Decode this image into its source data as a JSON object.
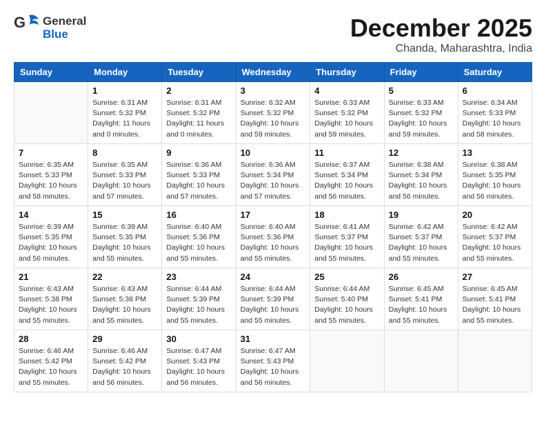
{
  "header": {
    "logo_general": "General",
    "logo_blue": "Blue",
    "month": "December 2025",
    "location": "Chanda, Maharashtra, India"
  },
  "weekdays": [
    "Sunday",
    "Monday",
    "Tuesday",
    "Wednesday",
    "Thursday",
    "Friday",
    "Saturday"
  ],
  "weeks": [
    [
      {
        "day": "",
        "info": ""
      },
      {
        "day": "1",
        "info": "Sunrise: 6:31 AM\nSunset: 5:32 PM\nDaylight: 11 hours\nand 0 minutes."
      },
      {
        "day": "2",
        "info": "Sunrise: 6:31 AM\nSunset: 5:32 PM\nDaylight: 11 hours\nand 0 minutes."
      },
      {
        "day": "3",
        "info": "Sunrise: 6:32 AM\nSunset: 5:32 PM\nDaylight: 10 hours\nand 59 minutes."
      },
      {
        "day": "4",
        "info": "Sunrise: 6:33 AM\nSunset: 5:32 PM\nDaylight: 10 hours\nand 59 minutes."
      },
      {
        "day": "5",
        "info": "Sunrise: 6:33 AM\nSunset: 5:32 PM\nDaylight: 10 hours\nand 59 minutes."
      },
      {
        "day": "6",
        "info": "Sunrise: 6:34 AM\nSunset: 5:33 PM\nDaylight: 10 hours\nand 58 minutes."
      }
    ],
    [
      {
        "day": "7",
        "info": "Sunrise: 6:35 AM\nSunset: 5:33 PM\nDaylight: 10 hours\nand 58 minutes."
      },
      {
        "day": "8",
        "info": "Sunrise: 6:35 AM\nSunset: 5:33 PM\nDaylight: 10 hours\nand 57 minutes."
      },
      {
        "day": "9",
        "info": "Sunrise: 6:36 AM\nSunset: 5:33 PM\nDaylight: 10 hours\nand 57 minutes."
      },
      {
        "day": "10",
        "info": "Sunrise: 6:36 AM\nSunset: 5:34 PM\nDaylight: 10 hours\nand 57 minutes."
      },
      {
        "day": "11",
        "info": "Sunrise: 6:37 AM\nSunset: 5:34 PM\nDaylight: 10 hours\nand 56 minutes."
      },
      {
        "day": "12",
        "info": "Sunrise: 6:38 AM\nSunset: 5:34 PM\nDaylight: 10 hours\nand 56 minutes."
      },
      {
        "day": "13",
        "info": "Sunrise: 6:38 AM\nSunset: 5:35 PM\nDaylight: 10 hours\nand 56 minutes."
      }
    ],
    [
      {
        "day": "14",
        "info": "Sunrise: 6:39 AM\nSunset: 5:35 PM\nDaylight: 10 hours\nand 56 minutes."
      },
      {
        "day": "15",
        "info": "Sunrise: 6:39 AM\nSunset: 5:35 PM\nDaylight: 10 hours\nand 55 minutes."
      },
      {
        "day": "16",
        "info": "Sunrise: 6:40 AM\nSunset: 5:36 PM\nDaylight: 10 hours\nand 55 minutes."
      },
      {
        "day": "17",
        "info": "Sunrise: 6:40 AM\nSunset: 5:36 PM\nDaylight: 10 hours\nand 55 minutes."
      },
      {
        "day": "18",
        "info": "Sunrise: 6:41 AM\nSunset: 5:37 PM\nDaylight: 10 hours\nand 55 minutes."
      },
      {
        "day": "19",
        "info": "Sunrise: 6:42 AM\nSunset: 5:37 PM\nDaylight: 10 hours\nand 55 minutes."
      },
      {
        "day": "20",
        "info": "Sunrise: 6:42 AM\nSunset: 5:37 PM\nDaylight: 10 hours\nand 55 minutes."
      }
    ],
    [
      {
        "day": "21",
        "info": "Sunrise: 6:43 AM\nSunset: 5:38 PM\nDaylight: 10 hours\nand 55 minutes."
      },
      {
        "day": "22",
        "info": "Sunrise: 6:43 AM\nSunset: 5:38 PM\nDaylight: 10 hours\nand 55 minutes."
      },
      {
        "day": "23",
        "info": "Sunrise: 6:44 AM\nSunset: 5:39 PM\nDaylight: 10 hours\nand 55 minutes."
      },
      {
        "day": "24",
        "info": "Sunrise: 6:44 AM\nSunset: 5:39 PM\nDaylight: 10 hours\nand 55 minutes."
      },
      {
        "day": "25",
        "info": "Sunrise: 6:44 AM\nSunset: 5:40 PM\nDaylight: 10 hours\nand 55 minutes."
      },
      {
        "day": "26",
        "info": "Sunrise: 6:45 AM\nSunset: 5:41 PM\nDaylight: 10 hours\nand 55 minutes."
      },
      {
        "day": "27",
        "info": "Sunrise: 6:45 AM\nSunset: 5:41 PM\nDaylight: 10 hours\nand 55 minutes."
      }
    ],
    [
      {
        "day": "28",
        "info": "Sunrise: 6:46 AM\nSunset: 5:42 PM\nDaylight: 10 hours\nand 55 minutes."
      },
      {
        "day": "29",
        "info": "Sunrise: 6:46 AM\nSunset: 5:42 PM\nDaylight: 10 hours\nand 56 minutes."
      },
      {
        "day": "30",
        "info": "Sunrise: 6:47 AM\nSunset: 5:43 PM\nDaylight: 10 hours\nand 56 minutes."
      },
      {
        "day": "31",
        "info": "Sunrise: 6:47 AM\nSunset: 5:43 PM\nDaylight: 10 hours\nand 56 minutes."
      },
      {
        "day": "",
        "info": ""
      },
      {
        "day": "",
        "info": ""
      },
      {
        "day": "",
        "info": ""
      }
    ]
  ]
}
